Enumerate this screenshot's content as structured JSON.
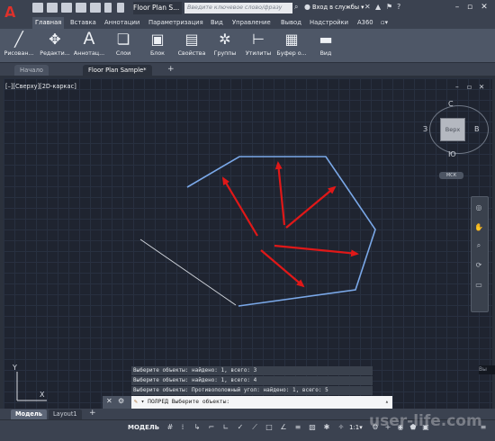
{
  "app": {
    "logo": "A",
    "doc_title": "Floor Plan S...",
    "search_placeholder": "Введите ключевое слово/фразу",
    "signin": "Вход в службы",
    "signin_arrow": "▾"
  },
  "ribbon_tabs": [
    "Главная",
    "Вставка",
    "Аннотации",
    "Параметризация",
    "Вид",
    "Управление",
    "Вывод",
    "Надстройки",
    "A360"
  ],
  "ribbon_buttons": [
    "Рисован...",
    "Редакти...",
    "Аннотац...",
    "Слои",
    "Блок",
    "Свойства",
    "Группы",
    "Утилиты",
    "Буфер о...",
    "Вид"
  ],
  "file_tabs": [
    "Начало",
    "Floor Plan Sample*"
  ],
  "file_tab_add": "+",
  "viewport": {
    "label": "[–][Сверху][2D-каркас]",
    "controls": [
      "–",
      "▫",
      "✕"
    ]
  },
  "viewcube": {
    "face": "Верх",
    "north": "С",
    "south": "Ю",
    "west": "З",
    "east": "В",
    "wcs": "МСК"
  },
  "ucs": {
    "y": "Y",
    "x": "X"
  },
  "command": {
    "history": [
      "Выберите объекты: найдено: 1, всего: 3",
      "Выберите объекты: найдено: 1, всего: 4",
      "Выберите объекты: Противоположный угол: найдено: 1, всего: 5"
    ],
    "prompt": "▾ ПОЛРЕД Выберите объекты:",
    "expand": "▴"
  },
  "side_text": "Вы",
  "layout_tabs": [
    "Модель",
    "Layout1"
  ],
  "layout_add": "+",
  "status": {
    "model": "МОДЕЛЬ",
    "scale": "1:1",
    "scale_arrow": "▾"
  },
  "watermark": "user-life.com",
  "colors": {
    "polyline": "#7aa8e8",
    "arrows": "#e01818",
    "line": "#cfd3da",
    "background": "#1f2430"
  }
}
